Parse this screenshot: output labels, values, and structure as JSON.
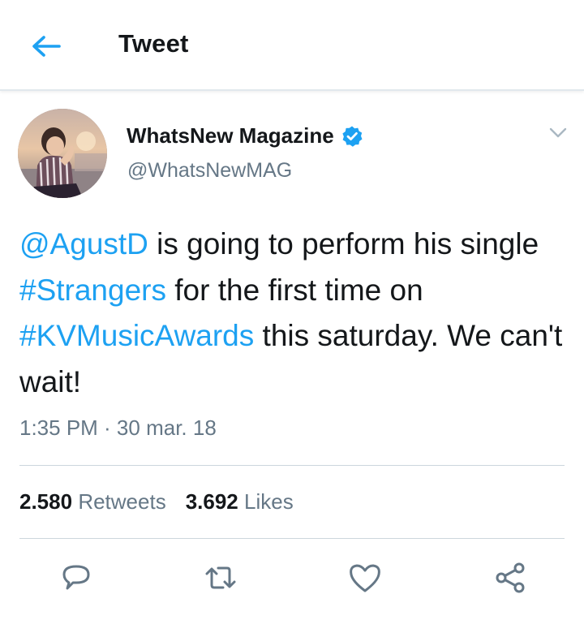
{
  "header": {
    "title": "Tweet",
    "back_icon": "arrow-left-icon"
  },
  "tweet": {
    "author_name": "WhatsNew Magazine",
    "handle": "@WhatsNewMAG",
    "verified": true,
    "text_parts": {
      "p1": "@AgustD",
      "p2": " is going to perform his single ",
      "p3": "#Strangers",
      "p4": " for the first time on ",
      "p5": "#KVMusicAwards",
      "p6": " this saturday. We can't wait!"
    },
    "timestamp": "1:35 PM · 30 mar. 18",
    "retweets_count": "2.580",
    "retweets_label": "Retweets",
    "likes_count": "3.692",
    "likes_label": "Likes"
  },
  "actions": [
    "reply-icon",
    "retweet-icon",
    "like-icon",
    "share-icon"
  ],
  "colors": {
    "accent": "#1da1f2",
    "text": "#14171a",
    "secondary": "#657786",
    "divider": "#ccd6dd",
    "icon_gray": "#657786"
  }
}
